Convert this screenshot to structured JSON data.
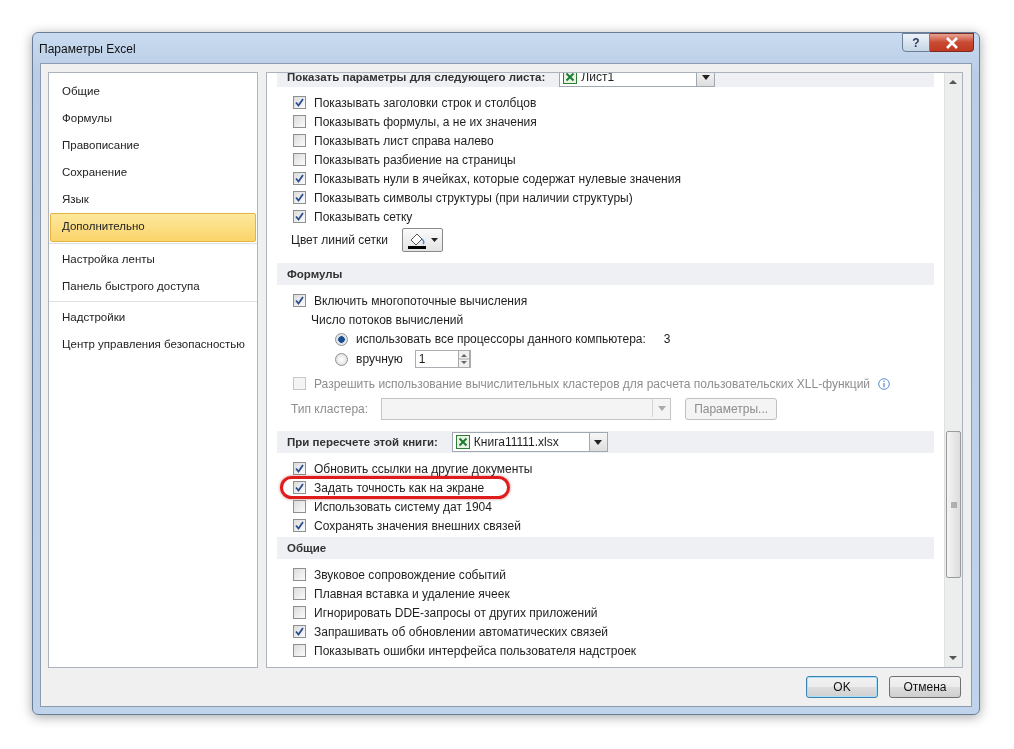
{
  "window": {
    "title": "Параметры Excel",
    "help_button": "?"
  },
  "sidebar": {
    "groups": [
      [
        {
          "label": "Общие",
          "selected": false
        },
        {
          "label": "Формулы",
          "selected": false
        },
        {
          "label": "Правописание",
          "selected": false
        },
        {
          "label": "Сохранение",
          "selected": false
        },
        {
          "label": "Язык",
          "selected": false
        },
        {
          "label": "Дополнительно",
          "selected": true
        }
      ],
      [
        {
          "label": "Настройка ленты",
          "selected": false
        },
        {
          "label": "Панель быстрого доступа",
          "selected": false
        }
      ],
      [
        {
          "label": "Надстройки",
          "selected": false
        },
        {
          "label": "Центр управления безопасностью",
          "selected": false
        }
      ]
    ]
  },
  "content": [
    {
      "kind": "header",
      "title": "Показать параметры для следующего листа:",
      "dropdown": "Лист1"
    },
    {
      "kind": "checkbox",
      "label": "Показывать заголовки строк и столбцов",
      "checked": true
    },
    {
      "kind": "checkbox",
      "label": "Показывать формулы, а не их значения",
      "checked": false
    },
    {
      "kind": "checkbox",
      "label": "Показывать лист справа налево",
      "checked": false
    },
    {
      "kind": "checkbox",
      "label": "Показывать разбиение на страницы",
      "checked": false
    },
    {
      "kind": "checkbox",
      "label": "Показывать нули в ячейках, которые содержат нулевые значения",
      "checked": true
    },
    {
      "kind": "checkbox",
      "label": "Показывать символы структуры (при наличии структуры)",
      "checked": true
    },
    {
      "kind": "checkbox",
      "label": "Показывать сетку",
      "checked": true
    },
    {
      "kind": "color",
      "label": "Цвет линий сетки"
    },
    {
      "kind": "header",
      "title": "Формулы"
    },
    {
      "kind": "checkbox",
      "label": "Включить многопоточные вычисления",
      "checked": true
    },
    {
      "kind": "text",
      "label": "Число потоков вычислений"
    },
    {
      "kind": "radio",
      "label": "использовать все процессоры данного компьютера:",
      "value": "3",
      "selected": true
    },
    {
      "kind": "radio",
      "label": "вручную",
      "spin": "1",
      "selected": false
    },
    {
      "kind": "checkbox",
      "label": "Разрешить использование вычислительных кластеров для расчета пользовательских XLL-функций",
      "checked": false,
      "disabled": true,
      "info": true
    },
    {
      "kind": "combo",
      "label": "Тип кластера:",
      "button": "Параметры...",
      "disabled": true
    },
    {
      "kind": "header",
      "title": "При пересчете этой книги:",
      "dropdown": "Книга11111.xlsx"
    },
    {
      "kind": "checkbox",
      "label": "Обновить ссылки на другие документы",
      "checked": true
    },
    {
      "kind": "checkbox",
      "label": "Задать точность как на экране",
      "checked": true,
      "highlighted": true
    },
    {
      "kind": "checkbox",
      "label": "Использовать систему дат 1904",
      "checked": false
    },
    {
      "kind": "checkbox",
      "label": "Сохранять значения внешних связей",
      "checked": true
    },
    {
      "kind": "header",
      "title": "Общие"
    },
    {
      "kind": "checkbox",
      "label": "Звуковое сопровождение событий",
      "checked": false
    },
    {
      "kind": "checkbox",
      "label": "Плавная вставка и удаление ячеек",
      "checked": false
    },
    {
      "kind": "checkbox",
      "label": "Игнорировать DDE-запросы от других приложений",
      "checked": false
    },
    {
      "kind": "checkbox",
      "label": "Запрашивать об обновлении автоматических связей",
      "checked": true
    },
    {
      "kind": "checkbox",
      "label": "Показывать ошибки интерфейса пользователя надстроек",
      "checked": false
    }
  ],
  "buttons": [
    {
      "label": "OK",
      "default": true
    },
    {
      "label": "Отмена",
      "default": false
    }
  ]
}
